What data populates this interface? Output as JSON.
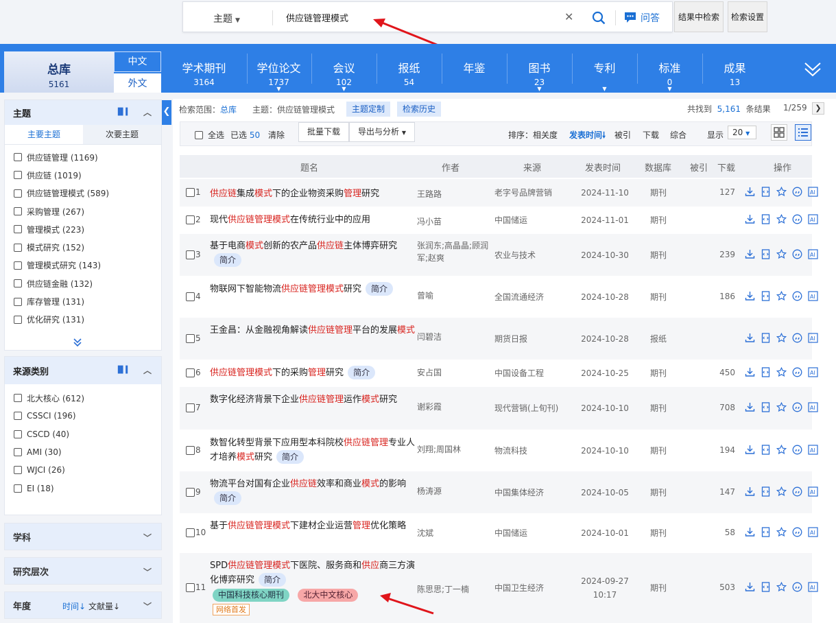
{
  "search": {
    "field": "主题",
    "query": "供应链管理模式",
    "qa_label": "问答",
    "btn_in_results": "结果中检索",
    "btn_settings": "检索设置"
  },
  "nav": {
    "total": {
      "label": "总库",
      "count": "5161"
    },
    "lang_cn": "中文",
    "lang_foreign": "外文",
    "items": [
      {
        "label": "学术期刊",
        "count": "3164"
      },
      {
        "label": "学位论文",
        "count": "1737"
      },
      {
        "label": "会议",
        "count": "102"
      },
      {
        "label": "报纸",
        "count": "54"
      },
      {
        "label": "年鉴",
        "count": ""
      },
      {
        "label": "图书",
        "count": "23"
      },
      {
        "label": "专利",
        "count": ""
      },
      {
        "label": "标准",
        "count": "0"
      },
      {
        "label": "成果",
        "count": "13"
      }
    ]
  },
  "sidebar": {
    "topic": {
      "title": "主题",
      "tab_main": "主要主题",
      "tab_secondary": "次要主题",
      "items": [
        "供应链管理 (1169)",
        "供应链 (1019)",
        "供应链管理模式 (589)",
        "采购管理 (267)",
        "管理模式 (223)",
        "模式研究 (152)",
        "管理模式研究 (143)",
        "供应链金融 (132)",
        "库存管理 (131)",
        "优化研究 (131)"
      ]
    },
    "source": {
      "title": "来源类别",
      "items": [
        "北大核心 (612)",
        "CSSCI (196)",
        "CSCD (40)",
        "AMI (30)",
        "WJCI (26)",
        "EI (18)"
      ]
    },
    "subject": "学科",
    "level": "研究层次",
    "year": {
      "title": "年度",
      "sort_time": "时间",
      "sort_count": "文献量"
    }
  },
  "main": {
    "scope_label": "检索范围：",
    "scope_value": "总库",
    "topic_label": "主题：供应链管理模式",
    "btn_topic_custom": "主题定制",
    "btn_history": "检索历史",
    "found_prefix": "共找到",
    "found_count": "5,161",
    "found_suffix": "条结果",
    "page": "1/259",
    "select_all": "全选",
    "selected_label": "已选",
    "selected_count": "50",
    "clear": "清除",
    "batch_download": "批量下载",
    "export": "导出与分析",
    "sort_label": "排序：",
    "sort_relevance": "相关度",
    "sort_date": "发表时间",
    "sort_cited": "被引",
    "sort_downloads": "下载",
    "sort_combined": "综合",
    "display_label": "显示",
    "page_size": "20",
    "columns": {
      "title": "题名",
      "author": "作者",
      "source": "来源",
      "date": "发表时间",
      "db": "数据库",
      "cited": "被引",
      "downloads": "下载",
      "ops": "操作"
    },
    "pill_abstract": "简介"
  },
  "rows": [
    {
      "n": "1",
      "title": [
        [
          "供应链",
          1
        ],
        [
          "集成",
          0
        ],
        [
          "模式",
          1
        ],
        [
          "下的企业物资采购",
          0
        ],
        [
          "管理",
          1
        ],
        [
          "研究",
          0
        ]
      ],
      "abstract": false,
      "author": "王路路",
      "source": "老字号品牌营销",
      "date": "2024-11-10",
      "db": "期刊",
      "downloads": "127"
    },
    {
      "n": "2",
      "title": [
        [
          "现代",
          0
        ],
        [
          "供应链管理模式",
          1
        ],
        [
          "在传统行业中的应用",
          0
        ]
      ],
      "abstract": false,
      "author": "冯小苗",
      "source": "中国储运",
      "date": "2024-11-01",
      "db": "期刊",
      "downloads": ""
    },
    {
      "n": "3",
      "title": [
        [
          "基于电商",
          0
        ],
        [
          "模式",
          1
        ],
        [
          "创新的农产品",
          0
        ],
        [
          "供应链",
          1
        ],
        [
          "主体博弈研究",
          0
        ]
      ],
      "abstract": true,
      "author": "张润东;高晶晶;顾润军;赵爽",
      "source": "农业与技术",
      "date": "2024-10-30",
      "db": "期刊",
      "downloads": "239"
    },
    {
      "n": "4",
      "title": [
        [
          "物联网下智能物流",
          0
        ],
        [
          "供应链管理模式",
          1
        ],
        [
          "研究",
          0
        ]
      ],
      "abstract": true,
      "author": "曾喻",
      "source": "全国流通经济",
      "date": "2024-10-28",
      "db": "期刊",
      "downloads": "186"
    },
    {
      "n": "5",
      "title": [
        [
          "王金昌：从金融视角解读",
          0
        ],
        [
          "供应链管理",
          1
        ],
        [
          "平台的发展",
          0
        ],
        [
          "模式",
          1
        ]
      ],
      "abstract": false,
      "author": "闫碧洁",
      "source": "期货日报",
      "date": "2024-10-28",
      "db": "报纸",
      "downloads": ""
    },
    {
      "n": "6",
      "title": [
        [
          "供应链管理模式",
          1
        ],
        [
          "下的采购",
          0
        ],
        [
          "管理",
          1
        ],
        [
          "研究",
          0
        ]
      ],
      "abstract": true,
      "author": "安占国",
      "source": "中国设备工程",
      "date": "2024-10-25",
      "db": "期刊",
      "downloads": "450"
    },
    {
      "n": "7",
      "title": [
        [
          "数字化经济背景下企业",
          0
        ],
        [
          "供应链管理",
          1
        ],
        [
          "运作",
          0
        ],
        [
          "模式",
          1
        ],
        [
          "研究",
          0
        ]
      ],
      "abstract": false,
      "author": "谢彩霞",
      "source": "现代营销(上旬刊)",
      "date": "2024-10-10",
      "db": "期刊",
      "downloads": "708"
    },
    {
      "n": "8",
      "title": [
        [
          "数智化转型背景下应用型本科院校",
          0
        ],
        [
          "供应链管理",
          1
        ],
        [
          "专业人才培养",
          0
        ],
        [
          "模式",
          1
        ],
        [
          "研究",
          0
        ]
      ],
      "abstract": true,
      "author": "刘翔;周国林",
      "source": "物流科技",
      "date": "2024-10-10",
      "db": "期刊",
      "downloads": "194"
    },
    {
      "n": "9",
      "title": [
        [
          "物流平台对国有企业",
          0
        ],
        [
          "供应链",
          1
        ],
        [
          "效率和商业",
          0
        ],
        [
          "模式",
          1
        ],
        [
          "的影响",
          0
        ]
      ],
      "abstract": true,
      "author": "杨涛源",
      "source": "中国集体经济",
      "date": "2024-10-05",
      "db": "期刊",
      "downloads": "147"
    },
    {
      "n": "10",
      "title": [
        [
          "基于",
          0
        ],
        [
          "供应链管理模式",
          1
        ],
        [
          "下建材企业运营",
          0
        ],
        [
          "管理",
          1
        ],
        [
          "优化策略",
          0
        ]
      ],
      "abstract": false,
      "author": "沈斌",
      "source": "中国储运",
      "date": "2024-10-01",
      "db": "期刊",
      "downloads": "58"
    },
    {
      "n": "11",
      "title": [
        [
          "SPD",
          0
        ],
        [
          "供应链管理模式",
          1
        ],
        [
          "下医院、服务商和",
          0
        ],
        [
          "供应",
          1
        ],
        [
          "商三方演化博弈研究",
          0
        ]
      ],
      "abstract": true,
      "author": "陈思思;丁一楠",
      "source": "中国卫生经济",
      "date": "2024-09-27",
      "time": "10:17",
      "db": "期刊",
      "downloads": "503",
      "tag_core": "中国科技核心期刊",
      "tag_pku": "北大中文核心",
      "tag_net": "网络首发"
    }
  ],
  "colors": {
    "nav_blue": "#2e7fe6",
    "highlight_red": "#d8231e",
    "link_blue": "#1a6fd4",
    "arrow_red": "#e0151b"
  },
  "icons": [
    "search-icon",
    "qa-chat-icon",
    "clear-icon",
    "download-icon",
    "html-read-icon",
    "favorite-star-icon",
    "quote-icon",
    "ai-icon",
    "grid-view-icon",
    "list-view-icon",
    "bar-chart-icon",
    "chevron-up-icon",
    "chevron-down-icon"
  ]
}
